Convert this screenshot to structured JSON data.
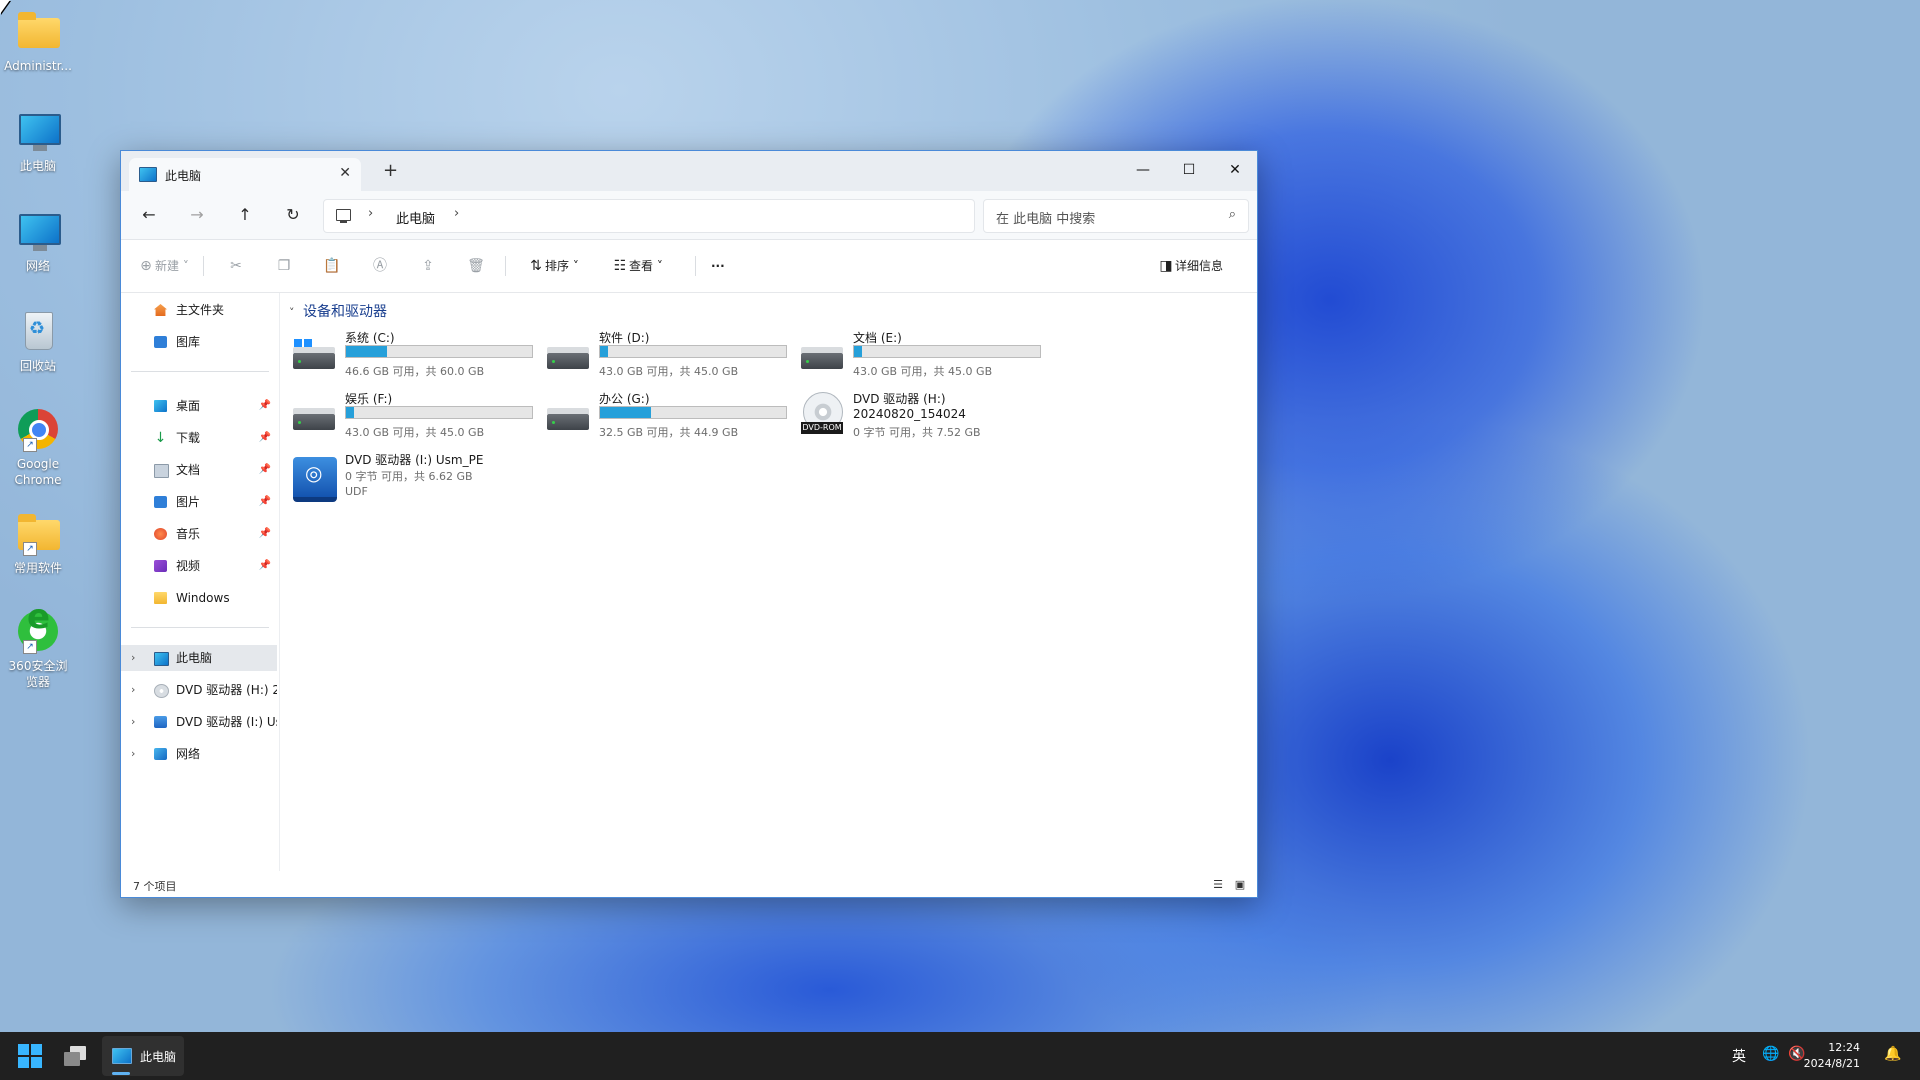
{
  "desktop": {
    "icons": [
      {
        "label": "Administr...",
        "icon": "folder-icon"
      },
      {
        "label": "此电脑",
        "icon": "computer-icon"
      },
      {
        "label": "网络",
        "icon": "network-icon"
      },
      {
        "label": "回收站",
        "icon": "recycle-bin-icon"
      },
      {
        "label": "Google Chrome",
        "icon": "chrome-icon"
      },
      {
        "label": "常用软件",
        "icon": "folder-icon"
      },
      {
        "label": "360安全浏览器",
        "icon": "browser-360-icon"
      }
    ]
  },
  "window": {
    "tab_title": "此电脑",
    "new_tab": "+",
    "controls": {
      "minimize": "—",
      "maximize": "☐",
      "close": "✕"
    },
    "address": {
      "location": "此电脑"
    },
    "search": {
      "placeholder": "在 此电脑 中搜索"
    },
    "toolbar": {
      "new_label": "新建",
      "sort_label": "排序",
      "view_label": "查看",
      "more_label": "···",
      "details_label": "详细信息"
    },
    "nav": {
      "top": [
        {
          "label": "主文件夹",
          "icon": "home-icon"
        },
        {
          "label": "图库",
          "icon": "gallery-icon"
        }
      ],
      "quick": [
        {
          "label": "桌面",
          "icon": "desktop-icon"
        },
        {
          "label": "下载",
          "icon": "download-icon"
        },
        {
          "label": "文档",
          "icon": "documents-icon"
        },
        {
          "label": "图片",
          "icon": "pictures-icon"
        },
        {
          "label": "音乐",
          "icon": "music-icon"
        },
        {
          "label": "视频",
          "icon": "videos-icon"
        },
        {
          "label": "Windows",
          "icon": "folder-icon"
        }
      ],
      "tree": [
        {
          "label": "此电脑",
          "icon": "computer-icon"
        },
        {
          "label": "DVD 驱动器 (H:) 2",
          "icon": "dvd-icon"
        },
        {
          "label": "DVD 驱动器 (I:) Us",
          "icon": "dvd-pe-icon"
        },
        {
          "label": "网络",
          "icon": "network-icon"
        }
      ]
    },
    "group_label": "设备和驱动器",
    "drives": [
      {
        "name": "系统 (C:)",
        "free": "46.6 GB 可用，共 60.0 GB",
        "used_fraction": 0.223,
        "icon": "windows-drive-icon"
      },
      {
        "name": "软件 (D:)",
        "free": "43.0 GB 可用，共 45.0 GB",
        "used_fraction": 0.044,
        "icon": "hard-drive-icon"
      },
      {
        "name": "文档 (E:)",
        "free": "43.0 GB 可用，共 45.0 GB",
        "used_fraction": 0.044,
        "icon": "hard-drive-icon"
      },
      {
        "name": "娱乐 (F:)",
        "free": "43.0 GB 可用，共 45.0 GB",
        "used_fraction": 0.044,
        "icon": "hard-drive-icon"
      },
      {
        "name": "办公 (G:)",
        "free": "32.5 GB 可用，共 44.9 GB",
        "used_fraction": 0.276,
        "icon": "hard-drive-icon"
      }
    ],
    "dvd_h": {
      "name": "DVD 驱动器 (H:)",
      "label": "20240820_154024",
      "free": "0 字节 可用，共 7.52 GB",
      "badge": "DVD-ROM"
    },
    "dvd_i": {
      "name": "DVD 驱动器 (I:) Usm_PE",
      "free": "0 字节 可用，共 6.62 GB",
      "fs": "UDF"
    },
    "status": {
      "count": "7 个项目"
    }
  },
  "taskbar": {
    "app_label": "此电脑",
    "ime": "英",
    "time": "12:24",
    "date": "2024/8/21"
  }
}
